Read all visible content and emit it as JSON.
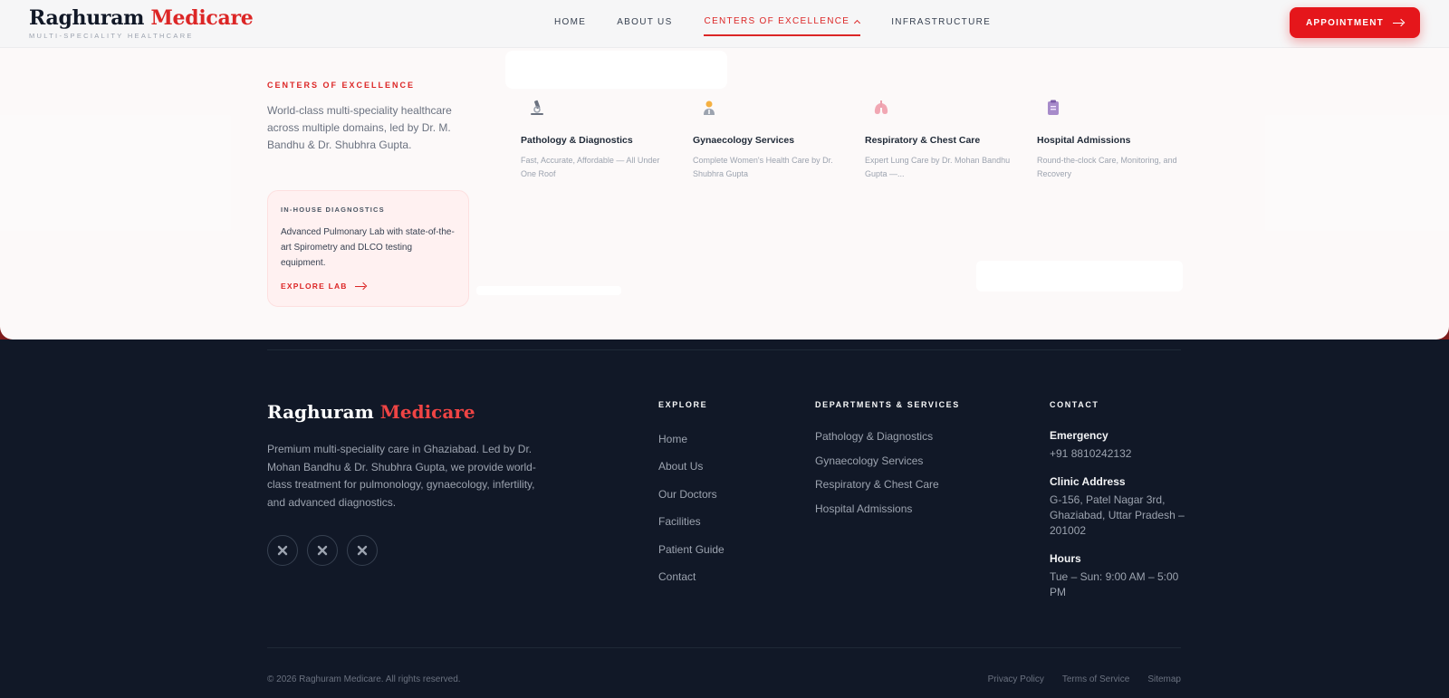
{
  "header": {
    "brand_primary": "Raghuram",
    "brand_accent": "Medicare",
    "tagline": "MULTI-SPECIALITY HEALTHCARE",
    "nav": {
      "home": "HOME",
      "about": "ABOUT US",
      "centers": "CENTERS OF EXCELLENCE",
      "infrastructure": "INFRASTRUCTURE"
    },
    "appointment_label": "APPOINTMENT"
  },
  "mega_menu": {
    "title": "CENTERS OF EXCELLENCE",
    "description": "World-class multi-speciality healthcare across multiple domains, led by Dr. M. Bandhu & Dr. Shubhra Gupta.",
    "lab_card": {
      "eyebrow": "IN-HOUSE DIAGNOSTICS",
      "text": "Advanced Pulmonary Lab with state-of-the-art Spirometry and DLCO testing equipment.",
      "link": "EXPLORE LAB"
    },
    "services": [
      {
        "icon": "microscope-icon",
        "title": "Pathology & Diagnostics",
        "desc": "Fast, Accurate, Affordable — All Under One Roof"
      },
      {
        "icon": "doctor-icon",
        "title": "Gynaecology Services",
        "desc": "Complete Women's Health Care by Dr. Shubhra Gupta"
      },
      {
        "icon": "lungs-icon",
        "title": "Respiratory & Chest Care",
        "desc": "Expert Lung Care by Dr. Mohan Bandhu Gupta —..."
      },
      {
        "icon": "clipboard-icon",
        "title": "Hospital Admissions",
        "desc": "Round-the-clock Care, Monitoring, and Recovery"
      }
    ]
  },
  "footer": {
    "brand_primary": "Raghuram",
    "brand_accent": "Medicare",
    "about": "Premium multi-speciality care in Ghaziabad. Led by Dr. Mohan Bandhu & Dr. Shubhra Gupta, we provide world-class treatment for pulmonology, gynaecology, infertility, and advanced diagnostics.",
    "explore_title": "EXPLORE",
    "explore_links": [
      "Home",
      "About Us",
      "Our Doctors",
      "Facilities",
      "Patient Guide",
      "Contact"
    ],
    "depts_title": "DEPARTMENTS & SERVICES",
    "dept_links": [
      "Pathology & Diagnostics",
      "Gynaecology Services",
      "Respiratory & Chest Care",
      "Hospital Admissions"
    ],
    "contact_title": "CONTACT",
    "emergency_label": "Emergency",
    "emergency_value": "+91 8810242132",
    "address_label": "Clinic Address",
    "address_value": "G-156, Patel Nagar 3rd, Ghaziabad, Uttar Pradesh – 201002",
    "hours_label": "Hours",
    "hours_value": "Tue – Sun: 9:00 AM – 5:00 PM",
    "copyright": "© 2026 Raghuram Medicare. All rights reserved.",
    "legal": [
      "Privacy Policy",
      "Terms of Service",
      "Sitemap"
    ]
  },
  "colors": {
    "accent": "#dc2626",
    "footer_bg": "#111827",
    "lab_card_bg": "#fff1f1"
  }
}
